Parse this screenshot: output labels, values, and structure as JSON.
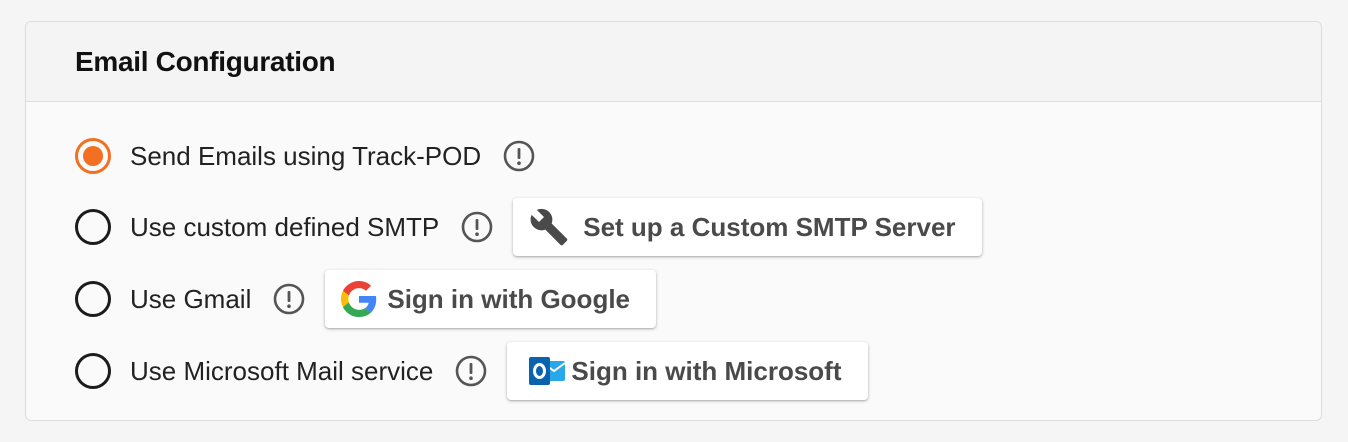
{
  "card": {
    "title": "Email Configuration"
  },
  "options": [
    {
      "label": "Send Emails using Track-POD",
      "checked": true,
      "info_icon": "exclamation-circle-icon"
    },
    {
      "label": "Use custom defined SMTP",
      "checked": false,
      "info_icon": "exclamation-circle-icon",
      "button": {
        "label": "Set up a Custom SMTP Server",
        "icon": "wrench-icon"
      }
    },
    {
      "label": "Use Gmail",
      "checked": false,
      "info_icon": "exclamation-circle-icon",
      "button": {
        "label": "Sign in with Google",
        "icon": "google-logo-icon"
      }
    },
    {
      "label": "Use Microsoft Mail service",
      "checked": false,
      "info_icon": "exclamation-circle-icon",
      "button": {
        "label": "Sign in with Microsoft",
        "icon": "outlook-logo-icon"
      }
    }
  ],
  "colors": {
    "accent": "#f36f21",
    "text": "#222222",
    "button_text": "#4a4a4a",
    "icon": "#555555"
  }
}
